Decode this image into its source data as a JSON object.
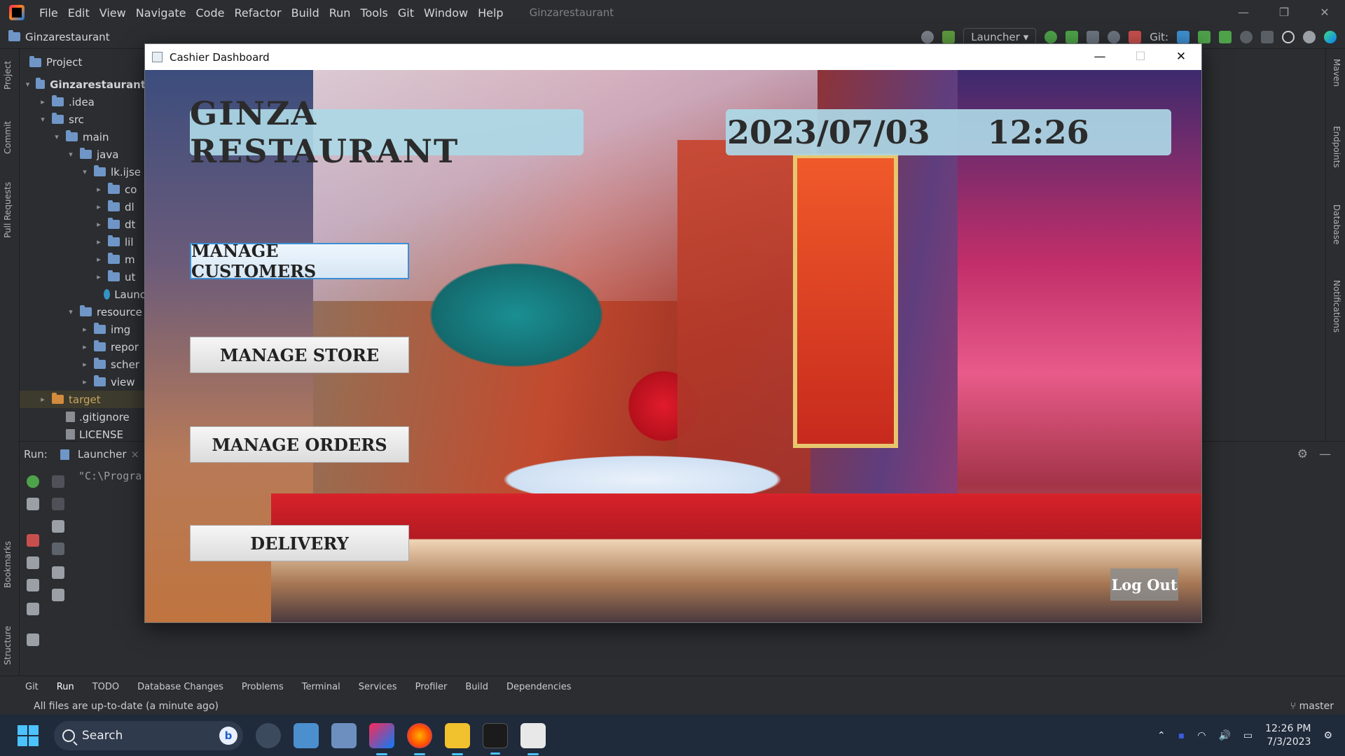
{
  "ide": {
    "menu": [
      "File",
      "Edit",
      "View",
      "Navigate",
      "Code",
      "Refactor",
      "Build",
      "Run",
      "Tools",
      "Git",
      "Window",
      "Help"
    ],
    "project_title": "Ginzarestaurant",
    "breadcrumb": "Ginzarestaurant",
    "run_config": "Launcher",
    "git_label": "Git:",
    "project_panel_title": "Project",
    "tree": [
      {
        "label": "Ginzarestaurant",
        "depth": 0,
        "type": "folder",
        "open": true
      },
      {
        "label": ".idea",
        "depth": 1,
        "type": "folder",
        "open": false
      },
      {
        "label": "src",
        "depth": 1,
        "type": "folder",
        "open": true
      },
      {
        "label": "main",
        "depth": 2,
        "type": "folder",
        "open": true
      },
      {
        "label": "java",
        "depth": 3,
        "type": "folder",
        "open": true
      },
      {
        "label": "lk.ijse",
        "depth": 4,
        "type": "folder",
        "open": true
      },
      {
        "label": "co",
        "depth": 5,
        "type": "folder",
        "open": false
      },
      {
        "label": "dl",
        "depth": 5,
        "type": "folder",
        "open": false
      },
      {
        "label": "dt",
        "depth": 5,
        "type": "folder",
        "open": false
      },
      {
        "label": "lil",
        "depth": 5,
        "type": "folder",
        "open": false
      },
      {
        "label": "m",
        "depth": 5,
        "type": "folder",
        "open": false
      },
      {
        "label": "ut",
        "depth": 5,
        "type": "folder",
        "open": false
      },
      {
        "label": "Launc",
        "depth": 5,
        "type": "class"
      },
      {
        "label": "resource",
        "depth": 3,
        "type": "folder",
        "open": true
      },
      {
        "label": "img",
        "depth": 4,
        "type": "folder",
        "open": false
      },
      {
        "label": "repor",
        "depth": 4,
        "type": "folder",
        "open": false
      },
      {
        "label": "scher",
        "depth": 4,
        "type": "folder",
        "open": false
      },
      {
        "label": "view",
        "depth": 4,
        "type": "folder",
        "open": false
      },
      {
        "label": "target",
        "depth": 1,
        "type": "folder-orange",
        "open": false
      },
      {
        "label": ".gitignore",
        "depth": 2,
        "type": "file"
      },
      {
        "label": "LICENSE",
        "depth": 2,
        "type": "file"
      }
    ],
    "left_strip": [
      "Project",
      "Commit",
      "Pull Requests",
      "Bookmarks",
      "Structure"
    ],
    "right_strip": [
      "Maven",
      "Endpoints",
      "Database",
      "Notifications"
    ],
    "run_label": "Run:",
    "run_tab": "Launcher",
    "console_text": "\"C:\\Progra",
    "bottom_tabs": [
      "Git",
      "Run",
      "TODO",
      "Database Changes",
      "Problems",
      "Terminal",
      "Services",
      "Profiler",
      "Build",
      "Dependencies"
    ],
    "active_bottom_tab": "Run",
    "status_text": "All files are up-to-date (a minute ago)",
    "branch": "master"
  },
  "window": {
    "title": "Cashier Dashboard",
    "minimize": "—",
    "maximize": "☐",
    "close": "✕"
  },
  "dashboard": {
    "restaurant_name": "GINZA RESTAURANT",
    "date": "2023/07/03",
    "time": "12:26",
    "buttons": {
      "manage_customers": "MANAGE CUSTOMERS",
      "manage_store": "MANAGE STORE",
      "manage_orders": "MANAGE ORDERS",
      "delivery": "DELIVERY"
    },
    "logout": "Log Out"
  },
  "taskbar": {
    "search_placeholder": "Search",
    "clock_time": "12:26 PM",
    "clock_date": "7/3/2023"
  }
}
